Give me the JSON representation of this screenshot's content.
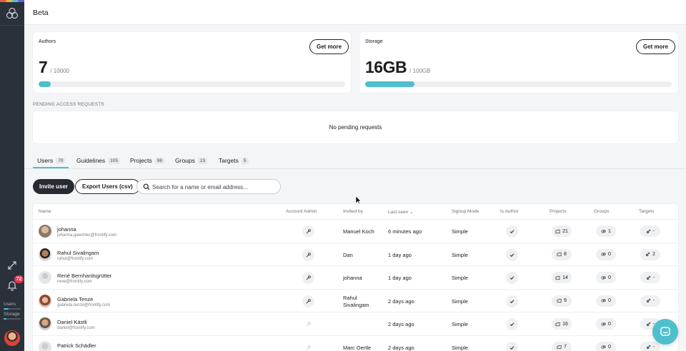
{
  "app": {
    "title": "Beta"
  },
  "sidebar": {
    "notification_count": "72",
    "users_label": "Users",
    "storage_label": "Storage",
    "users_fill": 0.3,
    "storage_fill": 0.16
  },
  "authors_card": {
    "label": "Authors",
    "value": "7",
    "max": "/ 10000",
    "button": "Get more",
    "fill": 0.04
  },
  "storage_card": {
    "label": "Storage",
    "value": "16GB",
    "max": "/ 100GB",
    "button": "Get more",
    "fill": 0.16
  },
  "pending": {
    "label": "PENDING ACCESS REQUESTS",
    "message": "No pending requests"
  },
  "tabs": [
    {
      "label": "Users",
      "count": "70"
    },
    {
      "label": "Guidelines",
      "count": "105"
    },
    {
      "label": "Projects",
      "count": "98"
    },
    {
      "label": "Groups",
      "count": "23"
    },
    {
      "label": "Targets",
      "count": "5"
    }
  ],
  "toolbar": {
    "invite_label": "Invite user",
    "export_label": "Export Users (csv)",
    "search_placeholder": "Search for a name or email address..."
  },
  "table": {
    "headers": {
      "name": "Name",
      "account_admin": "Account Admin",
      "invited_by": "Invited by",
      "last_seen": "Last seen",
      "signup_mode": "Signup Mode",
      "is_author": "Is Author",
      "projects": "Projects",
      "groups": "Groups",
      "targets": "Targets"
    },
    "rows": [
      {
        "name": "johanna",
        "email": "johanna.gaechter@frontify.com",
        "invited_by": "Manuel Koch",
        "last_seen": "6 minutes ago",
        "signup": "Simple",
        "projects": "21",
        "groups": "1",
        "targets": "-"
      },
      {
        "name": "Rahul Sivalingam",
        "email": "rahul@frontify.com",
        "invited_by": "Dan",
        "last_seen": "1 day ago",
        "signup": "Simple",
        "projects": "8",
        "groups": "0",
        "targets": "2"
      },
      {
        "name": "René Bernhardsgrütter",
        "email": "rene@frontify.com",
        "invited_by": "johanna",
        "last_seen": "1 day ago",
        "signup": "Simple",
        "projects": "14",
        "groups": "0",
        "targets": "-"
      },
      {
        "name": "Gabriela Tenze",
        "email": "gabriela.tenze@frontify.com",
        "invited_by_1": "Rahul",
        "invited_by_2": "Sivalingam",
        "last_seen": "2 days ago",
        "signup": "Simple",
        "projects": "9",
        "groups": "0",
        "targets": "-"
      },
      {
        "name": "Daniel Kästli",
        "email": "daniel@frontify.com",
        "invited_by": "",
        "last_seen": "2 days ago",
        "signup": "Simple",
        "projects": "16",
        "groups": "0",
        "targets": "-"
      },
      {
        "name": "Patrick Schädler",
        "email": "",
        "invited_by": "Marc Oertle",
        "last_seen": "2 days ago",
        "signup": "Simple",
        "projects": "7",
        "groups": "0",
        "targets": "-"
      }
    ]
  },
  "colors": {
    "accent": "#4ebfcd",
    "sidebar": "#2b313b",
    "badge": "#e0344f"
  }
}
